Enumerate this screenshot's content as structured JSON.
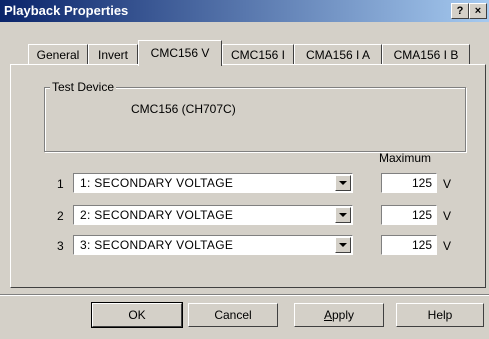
{
  "window": {
    "title": "Playback Properties",
    "help_btn": "?",
    "close_btn": "×"
  },
  "tabs": [
    {
      "label": "General"
    },
    {
      "label": "Invert"
    },
    {
      "label": "CMC156 V",
      "active": true
    },
    {
      "label": "CMC156 I"
    },
    {
      "label": "CMA156 I A"
    },
    {
      "label": "CMA156 I B"
    }
  ],
  "test_device": {
    "legend": "Test Device",
    "value": "CMC156 (CH707C)"
  },
  "max_header": "Maximum",
  "rows": [
    {
      "num": "1",
      "selection": "1: SECONDARY VOLTAGE",
      "max": "125",
      "unit": "V"
    },
    {
      "num": "2",
      "selection": "2: SECONDARY VOLTAGE",
      "max": "125",
      "unit": "V"
    },
    {
      "num": "3",
      "selection": "3: SECONDARY VOLTAGE",
      "max": "125",
      "unit": "V"
    }
  ],
  "buttons": {
    "ok": "OK",
    "cancel": "Cancel",
    "apply_prefix": "A",
    "apply_rest": "pply",
    "help": "Help"
  }
}
